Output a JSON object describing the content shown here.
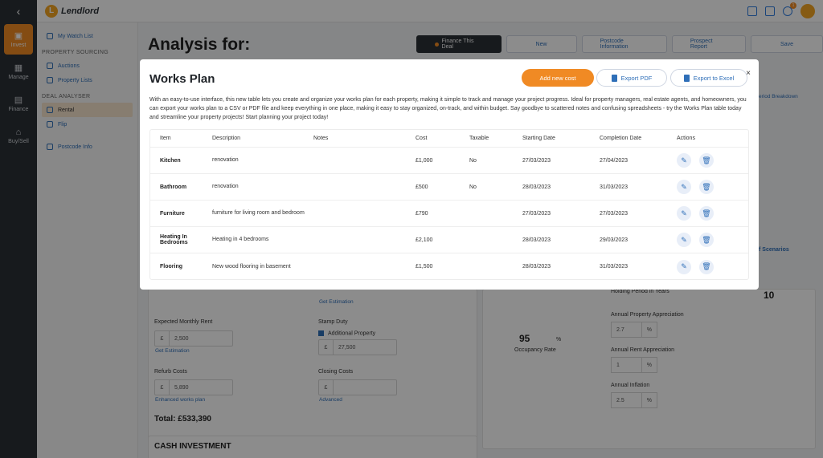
{
  "brand": {
    "name": "Lendlord"
  },
  "rail": {
    "items": [
      {
        "label": "Invest",
        "icon": "invest-icon"
      },
      {
        "label": "Manage",
        "icon": "manage-icon"
      },
      {
        "label": "Finance",
        "icon": "finance-icon"
      },
      {
        "label": "Buy/Sell",
        "icon": "buysell-icon"
      }
    ]
  },
  "topbar": {
    "notification_count": "1"
  },
  "sidenav": {
    "watch_list": "My Watch List",
    "sourcing_heading": "PROPERTY SOURCING",
    "auctions": "Auctions",
    "property_lists": "Property Lists",
    "analyser_heading": "DEAL ANALYSER",
    "rental": "Rental",
    "flip": "Flip",
    "postcode_info": "Postcode Info"
  },
  "page": {
    "title": "Analysis for:",
    "actions": {
      "finance": "Finance This Deal",
      "new": "New",
      "postcode": "Postcode Information",
      "report": "Prospect Report",
      "save": "Save"
    }
  },
  "background": {
    "expected_rent_label": "Expected Monthly Rent",
    "expected_rent_value": "2,500",
    "get_estimation": "Get Estimation",
    "get_estimation_top": "Get Estimation",
    "stamp_duty_label": "Stamp Duty",
    "additional_property": "Additional Property",
    "stamp_duty_value": "27,500",
    "refurb_label": "Refurb Costs",
    "refurb_value": "5,890",
    "enhanced_works_plan": "Enhanced works plan",
    "closing_label": "Closing Costs",
    "advanced": "Advanced",
    "total": "Total: £533,390",
    "cash_investment": "CASH INVESTMENT",
    "occupancy_value": "95",
    "occupancy_label": "Occupancy Rate",
    "holding_label": "Holding Period in Years",
    "holding_value": "10",
    "appreciation_label": "Annual Property Appreciation",
    "appreciation_value": "2.7",
    "rent_appreciation_label": "Annual Rent Appreciation",
    "rent_appreciation_value": "1",
    "inflation_label": "Annual Inflation",
    "inflation_value": "2.5",
    "currency": "£",
    "percent": "%",
    "period_breakdown": "eriod Breakdown",
    "scenarios": "f Scenarios"
  },
  "modal": {
    "title": "Works Plan",
    "add_button": "Add new cost",
    "export_pdf": "Export PDF",
    "export_excel": "Export to Excel",
    "close": "×",
    "description": "With an easy-to-use interface, this new table lets you create and organize your works plan for each property, making it simple to track and manage your project progress. Ideal for property managers, real estate agents, and homeowners, you can export your works plan to a CSV or PDF file and keep everything in one place, making it easy to stay organized, on-track, and within budget. Say goodbye to scattered notes and confusing spreadsheets - try the Works Plan table today and streamline your property projects! Start planning your project today!",
    "columns": {
      "item": "Item",
      "description": "Description",
      "notes": "Notes",
      "cost": "Cost",
      "taxable": "Taxable",
      "start": "Starting Date",
      "end": "Completion Date",
      "actions": "Actions"
    },
    "rows": [
      {
        "item": "Kitchen",
        "description": "renovation",
        "notes": "",
        "cost": "£1,000",
        "taxable": "No",
        "start": "27/03/2023",
        "end": "27/04/2023"
      },
      {
        "item": "Bathroom",
        "description": "renovation",
        "notes": "",
        "cost": "£500",
        "taxable": "No",
        "start": "28/03/2023",
        "end": "31/03/2023"
      },
      {
        "item": "Furniture",
        "description": "furniture for living room and bedroom",
        "notes": "",
        "cost": "£790",
        "taxable": "",
        "start": "27/03/2023",
        "end": "27/03/2023"
      },
      {
        "item": "Heating In Bedrooms",
        "description": "Heating in 4 bedrooms",
        "notes": "",
        "cost": "£2,100",
        "taxable": "",
        "start": "28/03/2023",
        "end": "29/03/2023"
      },
      {
        "item": "Flooring",
        "description": "New wood flooring in basement",
        "notes": "",
        "cost": "£1,500",
        "taxable": "",
        "start": "28/03/2023",
        "end": "31/03/2023"
      }
    ]
  }
}
